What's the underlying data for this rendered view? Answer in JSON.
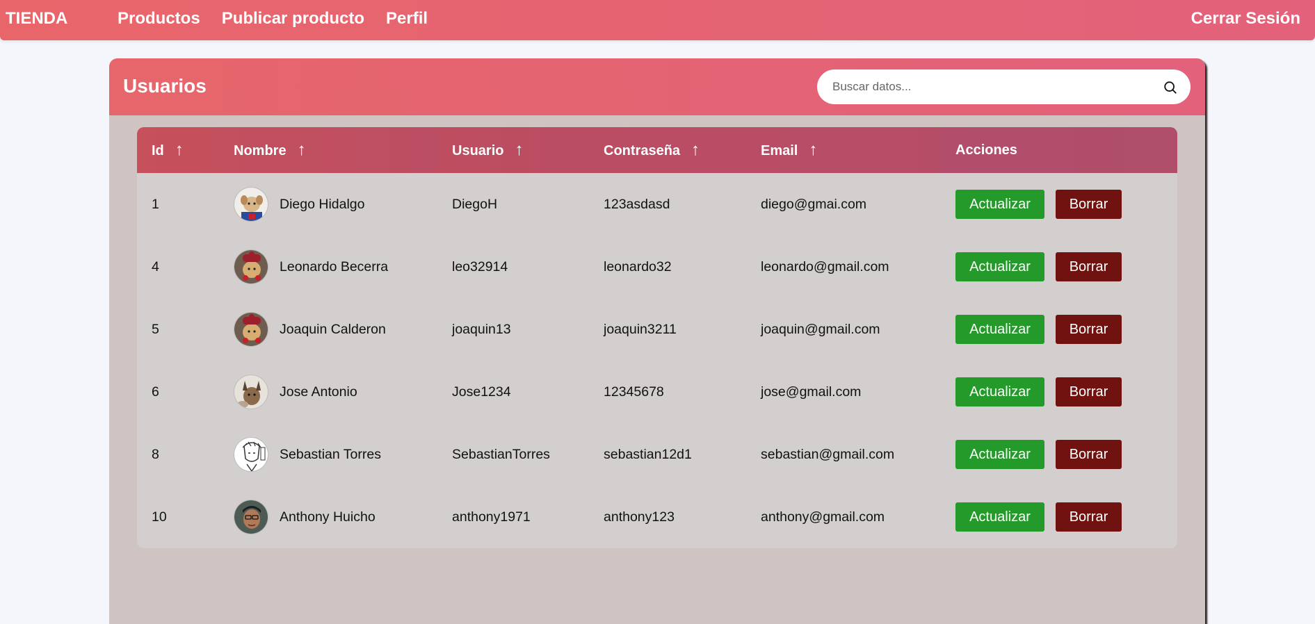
{
  "navbar": {
    "brand": "TIENDA",
    "links": [
      "Productos",
      "Publicar producto",
      "Perfil"
    ],
    "logout": "Cerrar Sesión"
  },
  "card": {
    "title": "Usuarios",
    "search_placeholder": "Buscar datos..."
  },
  "table": {
    "columns": [
      "Id",
      "Nombre",
      "Usuario",
      "Contraseña",
      "Email",
      "Acciones"
    ],
    "sort_arrow": "↑",
    "update_label": "Actualizar",
    "delete_label": "Borrar",
    "rows": [
      {
        "id": "1",
        "nombre": "Diego Hidalgo",
        "usuario": "DiegoH",
        "contrasena": "123asdasd",
        "email": "diego@gmai.com"
      },
      {
        "id": "4",
        "nombre": "Leonardo Becerra",
        "usuario": "leo32914",
        "contrasena": "leonardo32",
        "email": "leonardo@gmail.com"
      },
      {
        "id": "5",
        "nombre": "Joaquin Calderon",
        "usuario": "joaquin13",
        "contrasena": "joaquin3211",
        "email": "joaquin@gmail.com"
      },
      {
        "id": "6",
        "nombre": "Jose Antonio",
        "usuario": "Jose1234",
        "contrasena": "12345678",
        "email": "jose@gmail.com"
      },
      {
        "id": "8",
        "nombre": "Sebastian Torres",
        "usuario": "SebastianTorres",
        "contrasena": "sebastian12d1",
        "email": "sebastian@gmail.com"
      },
      {
        "id": "10",
        "nombre": "Anthony Huicho",
        "usuario": "anthony1971",
        "contrasena": "anthony123",
        "email": "anthony@gmail.com"
      }
    ]
  },
  "colors": {
    "accent": "#e4636f",
    "update": "#249a2a",
    "delete": "#701310"
  }
}
